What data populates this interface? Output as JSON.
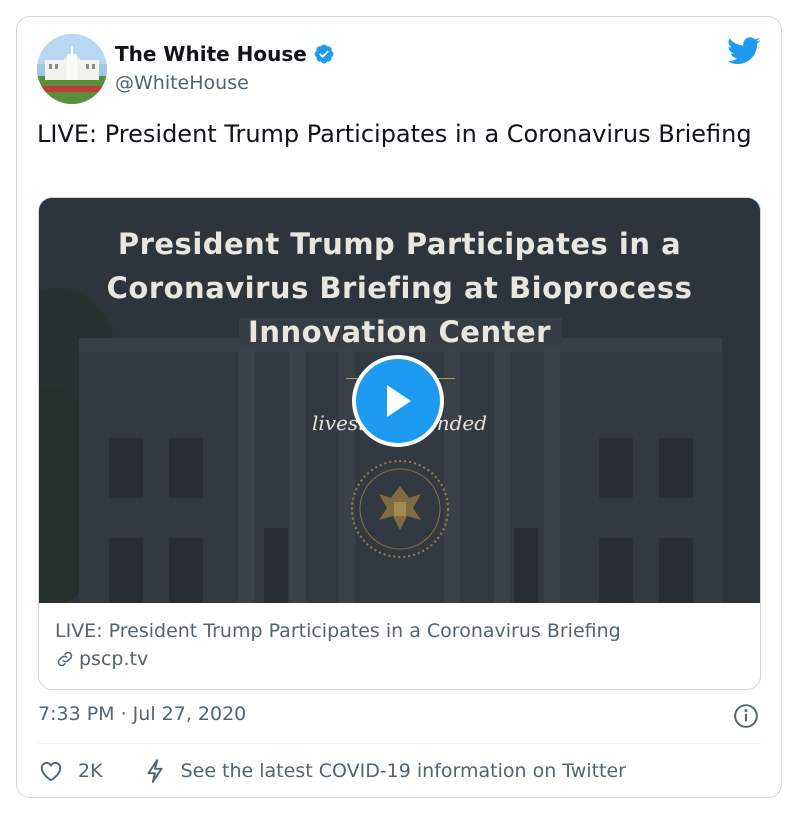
{
  "author": {
    "display_name": "The White House",
    "handle": "@WhiteHouse",
    "verified": true
  },
  "tweet": {
    "text": "LIVE: President Trump Participates in a Coronavirus Briefing"
  },
  "card": {
    "media_title_lines": [
      "President Trump Participates in a",
      "Coronavirus Briefing at Bioprocess",
      "Innovation Center"
    ],
    "media_subtitle": "livestream ended",
    "title": "LIVE: President Trump Participates in a Coronavirus Briefing",
    "domain": "pscp.tv"
  },
  "meta": {
    "timestamp": "7:33 PM · Jul 27, 2020"
  },
  "actions": {
    "like_count": "2K",
    "covid_link": "See the latest COVID-19 information on Twitter"
  },
  "colors": {
    "twitter_blue": "#1d9bf0",
    "text_primary": "#0f1419",
    "text_secondary": "#536471",
    "border": "#cfd9de"
  },
  "icons": [
    "verified-badge-icon",
    "twitter-bird-icon",
    "play-icon",
    "presidential-seal-icon",
    "link-icon",
    "info-icon",
    "heart-icon",
    "bolt-icon"
  ]
}
